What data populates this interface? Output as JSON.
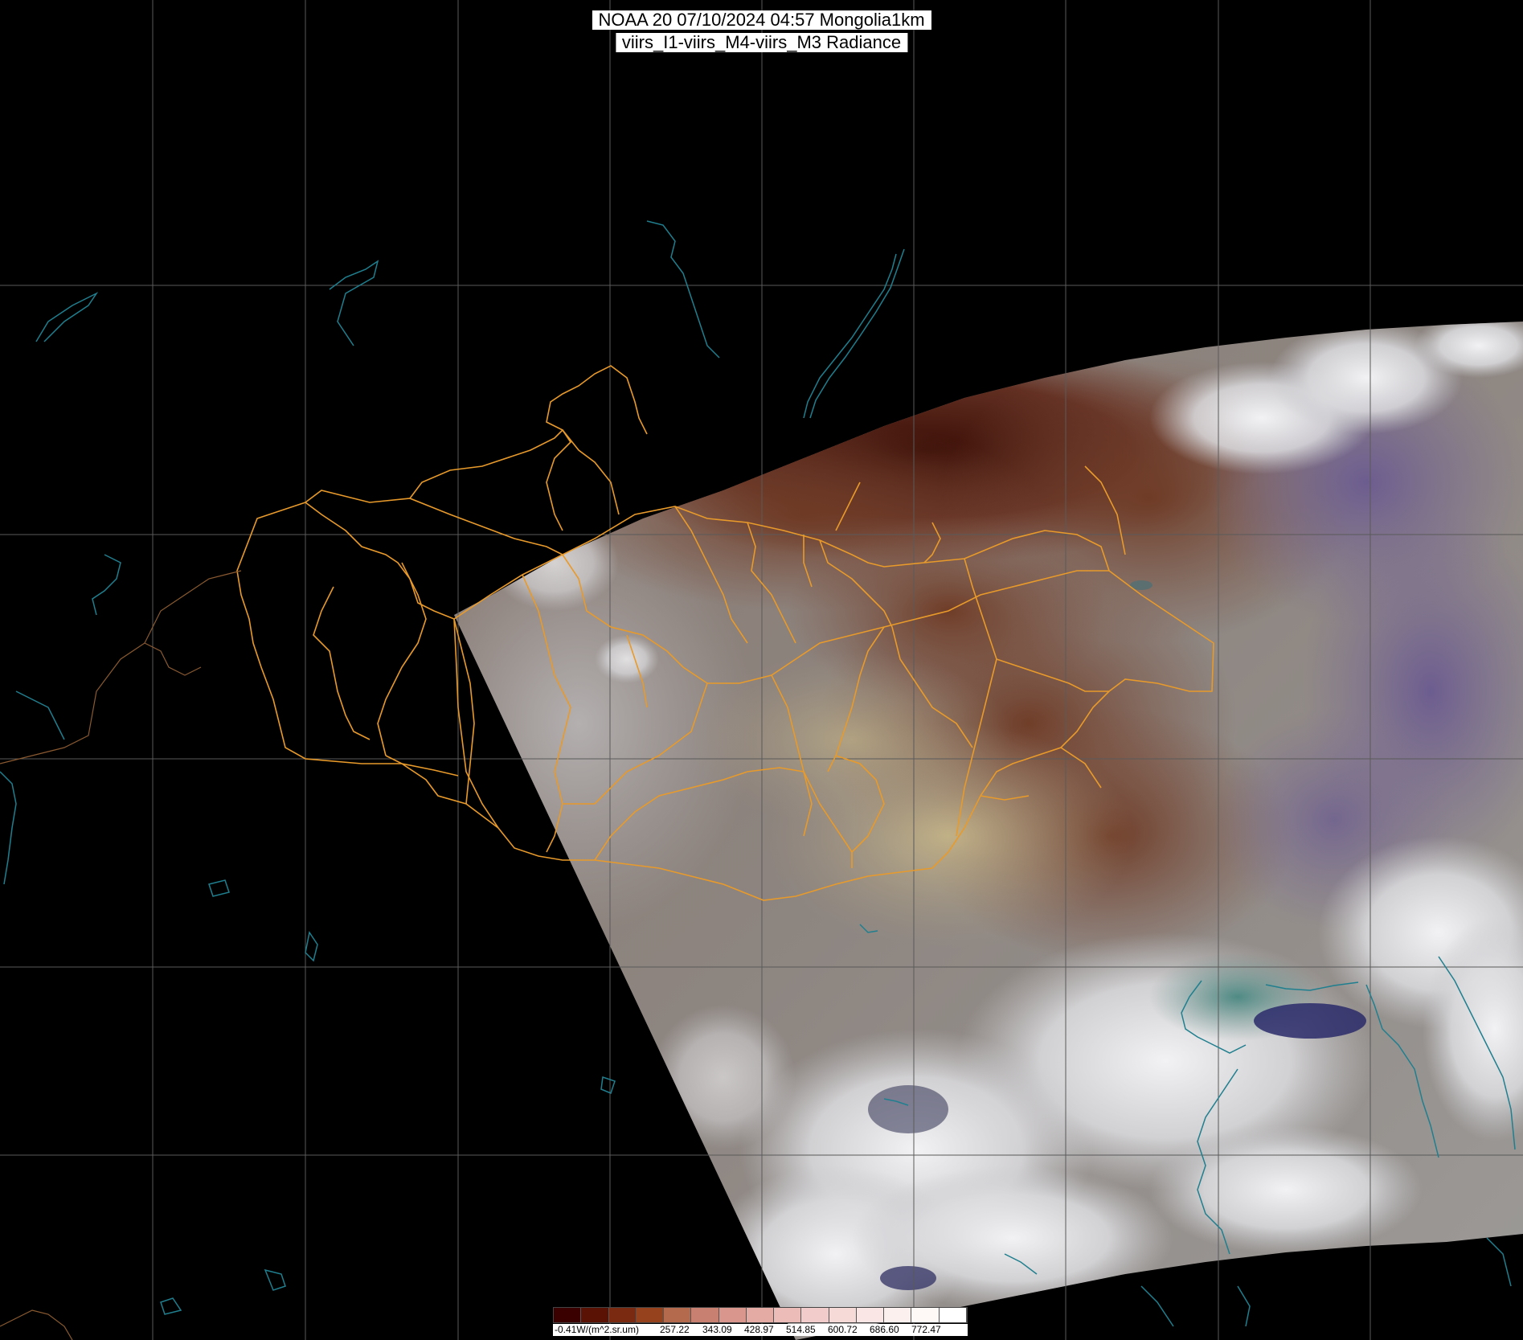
{
  "header": {
    "line1": "NOAA 20 07/10/2024 04:57 Mongolia1km",
    "line2": "viirs_I1-viirs_M4-viirs_M3 Radiance"
  },
  "legend": {
    "unit_label": "-0.41W/(m^2.sr.um)",
    "tick_labels": [
      "257.22",
      "343.09",
      "428.97",
      "514.85",
      "600.72",
      "686.60",
      "772.47"
    ],
    "colors": [
      "#3a0000",
      "#5a1205",
      "#7a2a10",
      "#96421c",
      "#b46a4c",
      "#c88070",
      "#d8968c",
      "#e4aaa4",
      "#ecbcb8",
      "#f2ccca",
      "#f6dad8",
      "#fae6e4",
      "#fcf0ee",
      "#fef8f6",
      "#ffffff"
    ]
  },
  "map": {
    "background_color": "#000000",
    "graticule_color": "#5a5a5a",
    "border_color": "#e89a2a",
    "coastline_color": "#1f7f8f",
    "province_border_color": "#c98a2a"
  }
}
